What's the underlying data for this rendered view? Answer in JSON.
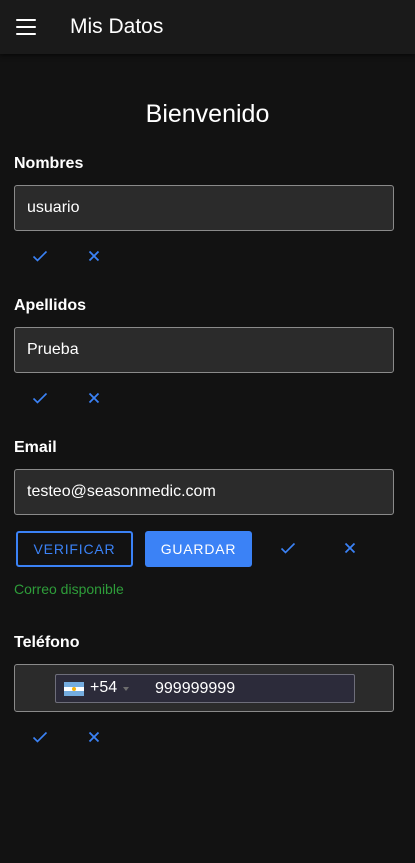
{
  "appbar": {
    "title": "Mis Datos",
    "menu_icon": "menu-icon"
  },
  "welcome": "Bienvenido",
  "nombres": {
    "label": "Nombres",
    "value": "usuario"
  },
  "apellidos": {
    "label": "Apellidos",
    "value": "Prueba"
  },
  "email": {
    "label": "Email",
    "value": "testeo@seasonmedic.com",
    "verify_label": "VERIFICAR",
    "save_label": "GUARDAR",
    "status": "Correo disponible"
  },
  "telefono": {
    "label": "Teléfono",
    "country_flag": "argentina-flag",
    "dial_code": "+54",
    "number": "999999999"
  },
  "colors": {
    "accent": "#3b82f6",
    "success": "#2e9d3a",
    "background": "#121212",
    "field_bg": "#2b2b2b"
  }
}
